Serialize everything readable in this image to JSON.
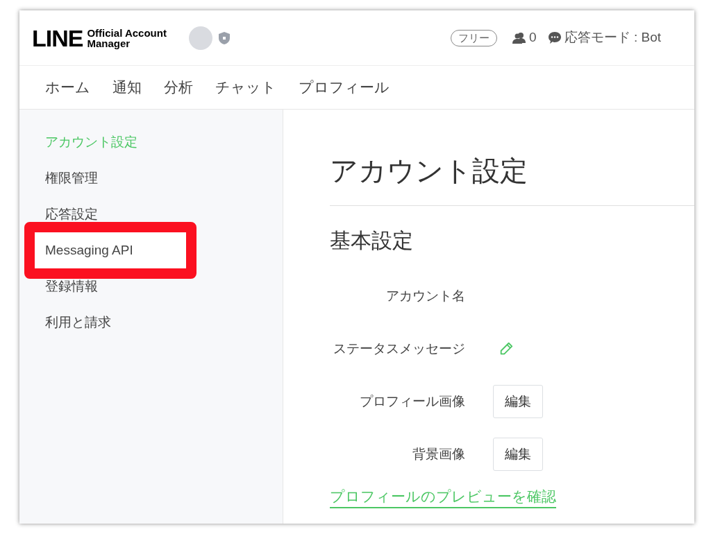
{
  "header": {
    "logo": {
      "brand": "LINE",
      "subtitle_1": "Official Account",
      "subtitle_2": "Manager"
    },
    "plan_badge": "フリー",
    "follower_count": "0",
    "response_mode": "応答モード : Bot"
  },
  "nav": [
    {
      "label": "ホーム"
    },
    {
      "label": "通知"
    },
    {
      "label": "分析"
    },
    {
      "label": "チャット"
    },
    {
      "label": "プロフィール"
    }
  ],
  "sidebar": {
    "items": [
      {
        "label": "アカウント設定",
        "selected": true,
        "annotated": false
      },
      {
        "label": "権限管理",
        "selected": false,
        "annotated": false
      },
      {
        "label": "応答設定",
        "selected": false,
        "annotated": false
      },
      {
        "label": "Messaging API",
        "selected": false,
        "annotated": true
      },
      {
        "label": "登録情報",
        "selected": false,
        "annotated": false
      },
      {
        "label": "利用と請求",
        "selected": false,
        "annotated": false
      }
    ]
  },
  "page_title": "アカウント設定",
  "section_title": "基本設定",
  "fields": [
    {
      "label": "アカウント名",
      "kind": "text"
    },
    {
      "label": "ステータスメッセージ",
      "kind": "edit_icon"
    },
    {
      "label": "プロフィール画像",
      "kind": "button",
      "button": "編集"
    },
    {
      "label": "背景画像",
      "kind": "button",
      "button": "編集"
    }
  ],
  "preview_link": "プロフィールのプレビューを確認"
}
